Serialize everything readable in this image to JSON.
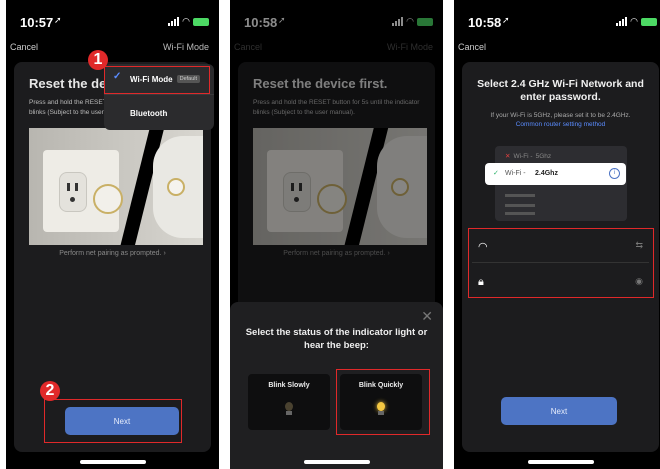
{
  "screen1": {
    "time": "10:57",
    "cancel": "Cancel",
    "mode_label": "Wi-Fi Mode",
    "title": "Reset the device first.",
    "desc": "Press and hold the RESET button for 5s until the indicator blinks (Subject to the user manual).",
    "pair_link": "Perform net pairing as prompted. ›",
    "dropdown": {
      "wifi_mode": "Wi-Fi Mode",
      "default_tag": "Default",
      "bluetooth": "Bluetooth"
    },
    "next": "Next",
    "badge1": "1",
    "badge2": "2"
  },
  "screen2": {
    "time": "10:58",
    "cancel": "Cancel",
    "mode_label": "Wi-Fi Mode",
    "title": "Reset the device first.",
    "desc": "Press and hold the RESET button for 5s until the indicator blinks (Subject to the user manual).",
    "pair_link": "Perform net pairing as prompted. ›",
    "sheet_title": "Select the status of the indicator light or hear the beep:",
    "option_slow": "Blink Slowly",
    "option_quick": "Blink Quickly"
  },
  "screen3": {
    "time": "10:58",
    "cancel": "Cancel",
    "title": "Select 2.4 GHz Wi-Fi Network and enter password.",
    "desc": "If your Wi-Fi is 5GHz, please set it to be 2.4GHz.",
    "link": "Common router setting method",
    "net_5g_prefix": "Wi-Fi - ",
    "net_5g": "5Ghz",
    "net_24_prefix": "Wi-Fi - ",
    "net_24": "2.4Ghz",
    "next": "Next"
  },
  "icons": [
    "location-arrow-icon",
    "signal-icon",
    "wifi-icon",
    "battery-icon",
    "check-icon",
    "close-icon",
    "bulb-icon",
    "lock-icon",
    "eye-icon",
    "swap-icon",
    "info-icon"
  ],
  "colors": {
    "accent": "#4d74c4",
    "highlight": "#e0292a",
    "link": "#5a8cff",
    "battery": "#4cd964"
  }
}
